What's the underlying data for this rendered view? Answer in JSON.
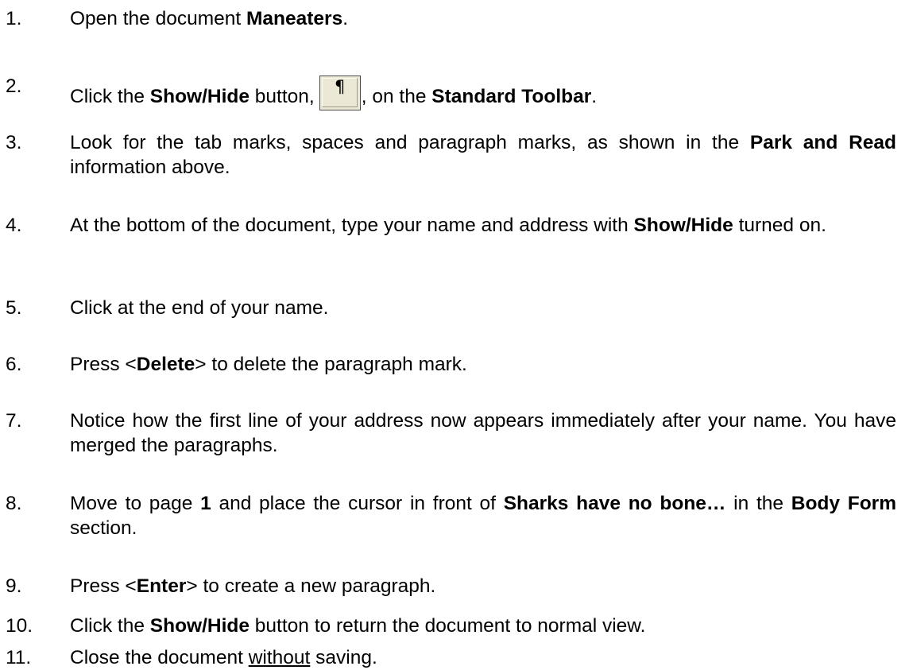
{
  "steps": [
    {
      "num": "1.",
      "parts": [
        {
          "text": "Open the document "
        },
        {
          "text": "Maneaters",
          "style": "b"
        },
        {
          "text": "."
        }
      ]
    },
    {
      "num": "2.",
      "parts": [
        {
          "text": "Click the "
        },
        {
          "text": "Show/Hide",
          "style": "b"
        },
        {
          "text": " button,"
        },
        {
          "button": "show-hide-button",
          "glyph": "¶"
        },
        {
          "text": ", on the "
        },
        {
          "text": "Standard Toolbar",
          "style": "b"
        },
        {
          "text": "."
        }
      ]
    },
    {
      "num": "3.",
      "parts": [
        {
          "text": "Look for the tab marks, spaces and paragraph marks, as shown in the "
        },
        {
          "text": "Park and Read",
          "style": "b"
        },
        {
          "text": " information above."
        }
      ]
    },
    {
      "num": "4.",
      "parts": [
        {
          "text": "At the bottom of the document, type your name and address with "
        },
        {
          "text": "Show/Hide",
          "style": "b"
        },
        {
          "text": " turned on."
        }
      ]
    },
    {
      "num": "5.",
      "parts": [
        {
          "text": "Click at the end of your name."
        }
      ]
    },
    {
      "num": "6.",
      "parts": [
        {
          "text": "Press <"
        },
        {
          "text": "Delete",
          "style": "b"
        },
        {
          "text": "> to delete the paragraph mark."
        }
      ]
    },
    {
      "num": "7.",
      "parts": [
        {
          "text": "Notice how the first line of your address now appears immediately after your name. You have merged the paragraphs."
        }
      ]
    },
    {
      "num": "8.",
      "parts": [
        {
          "text": "Move to page "
        },
        {
          "text": "1",
          "style": "b"
        },
        {
          "text": " and place the cursor in front of "
        },
        {
          "text": "Sharks have no bone…",
          "style": "b"
        },
        {
          "text": " in the "
        },
        {
          "text": "Body Form",
          "style": "b"
        },
        {
          "text": " section."
        }
      ]
    },
    {
      "num": "9.",
      "parts": [
        {
          "text": "Press <"
        },
        {
          "text": "Enter",
          "style": "b"
        },
        {
          "text": "> to create a new paragraph."
        }
      ]
    },
    {
      "num": "10.",
      "parts": [
        {
          "text": "Click the "
        },
        {
          "text": "Show/Hide",
          "style": "b"
        },
        {
          "text": " button to return the document to normal view."
        }
      ]
    },
    {
      "num": "11.",
      "parts": [
        {
          "text": "Close the document "
        },
        {
          "text": "without",
          "style": "u"
        },
        {
          "text": " saving."
        }
      ]
    }
  ]
}
